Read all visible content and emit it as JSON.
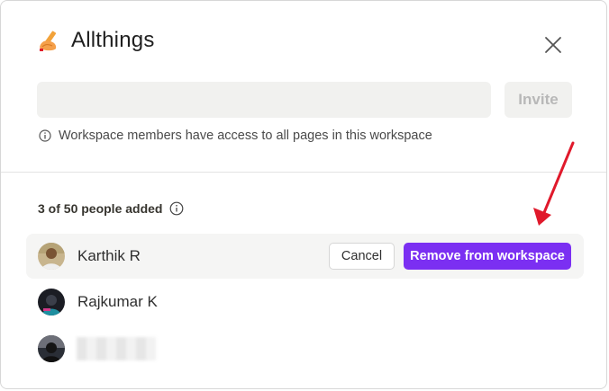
{
  "workspace": {
    "name": "Allthings",
    "icon": "writing-hand-icon"
  },
  "invite": {
    "input_value": "",
    "button_label": "Invite"
  },
  "note": "Workspace members have access to all pages in this workspace",
  "members_count": "3 of 50 people added",
  "members": [
    {
      "name": "Karthik R",
      "avatar": "avatar-photo"
    },
    {
      "name": "Rajkumar K",
      "avatar": "avatar-photo"
    },
    {
      "name": "",
      "avatar": "avatar-photo",
      "name_blurred": true
    }
  ],
  "actions": {
    "cancel_label": "Cancel",
    "remove_label": "Remove from workspace"
  },
  "colors": {
    "primary_button": "#7b2ff2",
    "annotation_arrow": "#e0192b"
  }
}
